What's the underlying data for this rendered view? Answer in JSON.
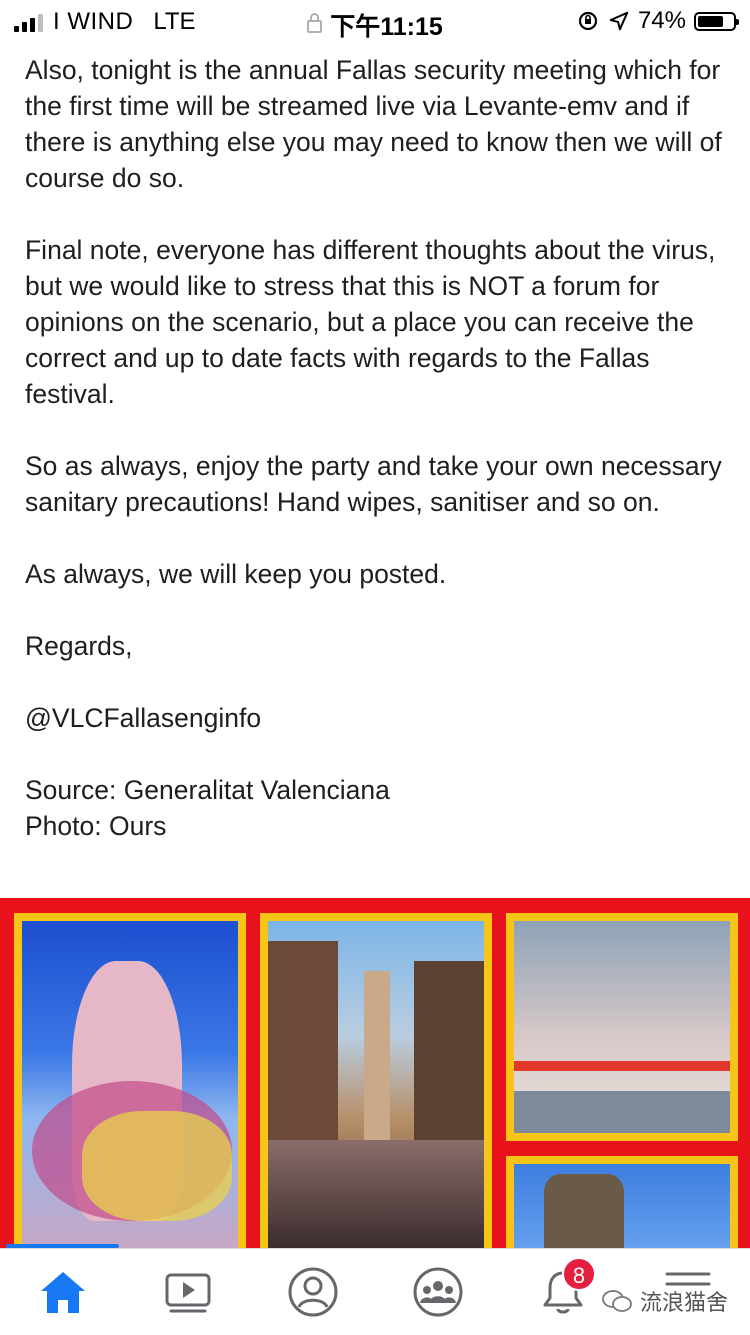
{
  "status_bar": {
    "carrier": "I WIND",
    "network": "LTE",
    "time": "下午11:15",
    "battery_percent": "74%",
    "battery_level": 0.74
  },
  "post": {
    "paragraphs": [
      "Also, tonight is the annual Fallas security meeting which for the first time will be streamed live via Levante-emv and if there is anything else you may need to know then we will of course do so.",
      "Final note, everyone has different thoughts about the virus, but we would like to stress that this is NOT a forum for opinions on the scenario, but a place you can receive the correct and up to date facts with regards to the Fallas festival.",
      "So as always, enjoy the party and take your own necessary sanitary precautions! Hand wipes, sanitiser and so on.",
      "As always, we will keep you posted.",
      "Regards,",
      "@VLCFallasenginfo"
    ],
    "source_line": "Source: Generalitat Valenciana",
    "photo_line": "Photo: Ours"
  },
  "bottom_nav": {
    "items": [
      {
        "icon": "home-icon",
        "active": true
      },
      {
        "icon": "video-icon",
        "active": false
      },
      {
        "icon": "profile-icon",
        "active": false
      },
      {
        "icon": "groups-icon",
        "active": false
      },
      {
        "icon": "notifications-icon",
        "active": false
      },
      {
        "icon": "menu-icon",
        "active": false
      }
    ],
    "notification_count": "8"
  },
  "watermark": {
    "text": "流浪猫舍"
  },
  "colors": {
    "accent": "#1877f2",
    "badge": "#e41e3f",
    "photo_border": "#f5c518",
    "photo_background": "#e8131b"
  }
}
